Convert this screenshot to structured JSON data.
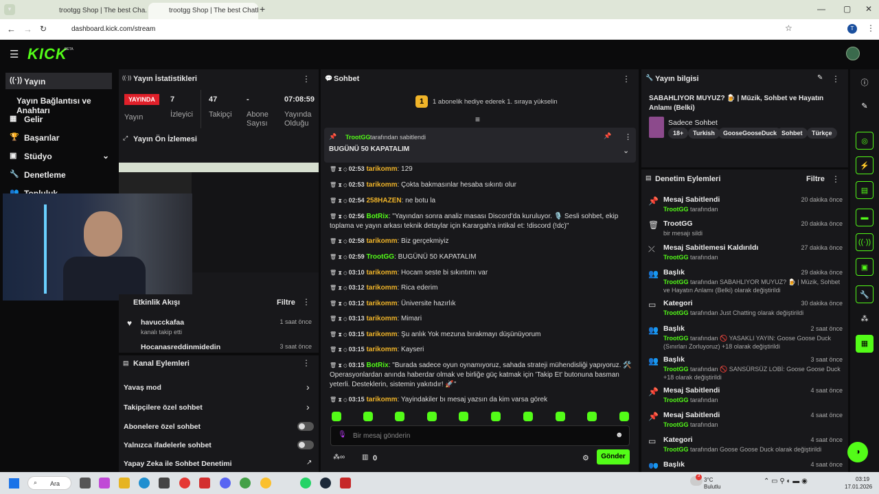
{
  "browser": {
    "tabs": [
      "trootgg Shop | The best Cha...",
      "trootgg Shop | The best ChatB..."
    ],
    "url": "dashboard.kick.com/stream",
    "profile_initial": "T"
  },
  "brand": {
    "logo": "KICK",
    "beta": "BETA",
    "accent": "#53fc18"
  },
  "sidebar": {
    "items": [
      {
        "label": "Yayın",
        "icon": "broadcast-icon"
      },
      {
        "label": "Yayın Bağlantısı ve Anahtarı",
        "icon": ""
      },
      {
        "label": "Gelir",
        "icon": "chart-icon"
      },
      {
        "label": "Başarılar",
        "icon": "trophy-icon"
      },
      {
        "label": "Stüdyo",
        "icon": "grid-icon"
      },
      {
        "label": "Denetleme",
        "icon": "wrench-icon"
      },
      {
        "label": "Topluluk",
        "icon": "people-icon"
      }
    ]
  },
  "stats": {
    "title": "Yayın İstatistikleri",
    "live_badge": "YAYINDA",
    "live_label": "Yayın",
    "viewers": "7",
    "viewers_label": "İzleyici",
    "followers": "47",
    "followers_label": "Takipçi",
    "subs": "-",
    "subs_label": "Abone Sayısı",
    "uptime": "07:08:59",
    "uptime_label": "Yayında Olduğu"
  },
  "preview": {
    "title": "Yayın Ön İzlemesi"
  },
  "activity": {
    "title": "Etkinlik Akışı",
    "filter": "Filtre",
    "items": [
      {
        "name": "havucckafaa",
        "desc": "kanalı takip etti",
        "time": "1 saat önce"
      },
      {
        "name": "Hocanasreddinmidedin",
        "desc": "",
        "time": "3 saat önce"
      }
    ]
  },
  "channel_actions": {
    "title": "Kanal Eylemleri",
    "items": [
      "Yavaş mod",
      "Takipçilere özel sohbet",
      "Abonelere özel sohbet",
      "Yalnızca ifadelerle sohbet",
      "Yapay Zeka ile Sohbet Denetimi"
    ]
  },
  "chat": {
    "title": "Sohbet",
    "gift_text": "1 abonelik hediye ederek 1. sıraya yükselin",
    "pinned_by": "TrootGG",
    "pinned_suffix": "tarafından sabitlendi",
    "pinned_text": "BUGÜNÜ 50 KAPATALIM",
    "messages": [
      {
        "time": "02:53",
        "user": "tarikomm",
        "text": "129"
      },
      {
        "time": "02:53",
        "user": "tarikomm",
        "text": "Çokta bakmasınlar hesaba sıkıntı olur"
      },
      {
        "time": "02:54",
        "user": "258HAZEN",
        "text": "ne botu la"
      },
      {
        "time": "02:56",
        "user": "BotRix",
        "text": "\"Yayından sonra analiz masası Discord'da kuruluyor. 🎙️ Sesli sohbet, ekip toplama ve yayın arkası teknik detaylar için Karargah'a intikal et: !discord (!dc)\""
      },
      {
        "time": "02:58",
        "user": "tarikomm",
        "text": "Biz gerçekmiyiz"
      },
      {
        "time": "02:59",
        "user": "TrootGG",
        "text": "BUGÜNÜ 50 KAPATALIM"
      },
      {
        "time": "03:10",
        "user": "tarikomm",
        "text": "Hocam seste bi sıkıntımı var"
      },
      {
        "time": "03:12",
        "user": "tarikomm",
        "text": "Rica ederim"
      },
      {
        "time": "03:12",
        "user": "tarikomm",
        "text": "Üniversite hazırlık"
      },
      {
        "time": "03:13",
        "user": "tarikomm",
        "text": "Mimari"
      },
      {
        "time": "03:15",
        "user": "tarikomm",
        "text": "Şu anlık Yok mezuna bırakmayı düşünüyorum"
      },
      {
        "time": "03:15",
        "user": "tarikomm",
        "text": "Kayseri"
      },
      {
        "time": "03:15",
        "user": "BotRix",
        "text": "\"Burada sadece oyun oynamıyoruz, sahada strateji mühendisliği yapıyoruz. 🛠️ Operasyonlardan anında haberdar olmak ve birliğe güç katmak için 'Takip Et' butonuna basman yeterli. Desteklerin, sistemin yakıtıdır! 🚀\""
      },
      {
        "time": "03:15",
        "user": "tarikomm",
        "text": "Yayindakiler bı mesaj yazsın da kim varsa görek"
      }
    ],
    "input_placeholder": "Bir mesaj gönderin",
    "points": "0",
    "send": "Gönder"
  },
  "info": {
    "title": "Yayın bilgisi",
    "stream_title": "SABAHLIYOR MUYUZ? 🍺 | Müzik, Sohbet ve Hayatın Anlamı (Belki)",
    "category": "Sadece Sohbet",
    "tags": [
      "18+",
      "Turkish",
      "GooseGooseDuck",
      "Sohbet",
      "Türkçe"
    ]
  },
  "moderation": {
    "title": "Denetim Eylemleri",
    "filter": "Filtre",
    "items": [
      {
        "icon": "pin-icon",
        "title": "Mesaj Sabitlendi",
        "user": "TrootGG",
        "rest": "tarafından",
        "time": "20 dakika önce"
      },
      {
        "icon": "trash-icon",
        "title": "TrootGG",
        "user": "",
        "rest": "bir mesajı sildi",
        "time": "20 dakika önce"
      },
      {
        "icon": "unpin-icon",
        "title": "Mesaj Sabitlemesi Kaldırıldı",
        "user": "TrootGG",
        "rest": "tarafından",
        "time": "27 dakika önce"
      },
      {
        "icon": "users-icon",
        "title": "Başlık",
        "user": "TrootGG",
        "rest": "tarafından SABAHLIYOR MUYUZ? 🍺 | Müzik, Sohbet ve Hayatın Anlamı (Belki) olarak değiştirildi",
        "time": "29 dakika önce"
      },
      {
        "icon": "category-icon",
        "title": "Kategori",
        "user": "TrootGG",
        "rest": "tarafından Just Chatting olarak değiştirildi",
        "time": "30 dakika önce"
      },
      {
        "icon": "users-icon",
        "title": "Başlık",
        "user": "TrootGG",
        "rest": "tarafından 🚫 YASAKLI YAYIN: Goose Goose Duck (Sınırları Zorluyoruz) +18 olarak değiştirildi",
        "time": "2 saat önce"
      },
      {
        "icon": "users-icon",
        "title": "Başlık",
        "user": "TrootGG",
        "rest": "tarafından 🚫 SANSÜRSÜZ LOBİ: Goose Goose Duck +18 olarak değiştirildi",
        "time": "3 saat önce"
      },
      {
        "icon": "pin-icon",
        "title": "Mesaj Sabitlendi",
        "user": "TrootGG",
        "rest": "tarafından",
        "time": "4 saat önce"
      },
      {
        "icon": "pin-icon",
        "title": "Mesaj Sabitlendi",
        "user": "TrootGG",
        "rest": "tarafından",
        "time": "4 saat önce"
      },
      {
        "icon": "category-icon",
        "title": "Kategori",
        "user": "TrootGG",
        "rest": "tarafından Goose Goose Duck olarak değiştirildi",
        "time": "4 saat önce"
      },
      {
        "icon": "users-icon",
        "title": "Başlık",
        "user": "",
        "rest": "",
        "time": "4 saat önce"
      }
    ]
  },
  "taskbar": {
    "search": "Ara",
    "weather_temp": "3°C",
    "weather_desc": "Bulutlu",
    "time": "03:19",
    "date": "17.01.2026",
    "notif": "3"
  }
}
